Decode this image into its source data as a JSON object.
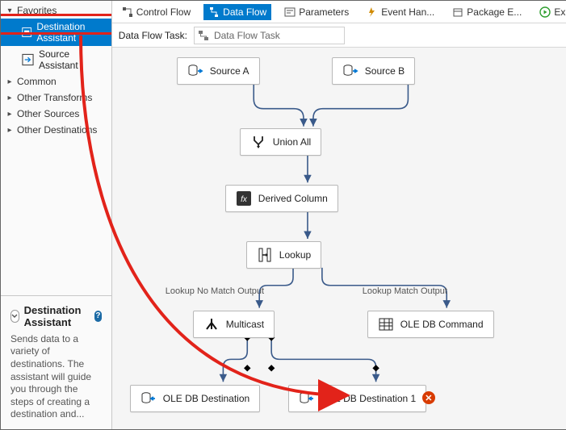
{
  "sidebar": {
    "categories": [
      {
        "label": "Favorites",
        "expanded": true,
        "items": [
          {
            "label": "Destination Assistant",
            "selected": true,
            "highlight": true
          },
          {
            "label": "Source Assistant"
          }
        ]
      },
      {
        "label": "Common",
        "expanded": false
      },
      {
        "label": "Other Transforms",
        "expanded": false
      },
      {
        "label": "Other Sources",
        "expanded": false
      },
      {
        "label": "Other Destinations",
        "expanded": false
      }
    ]
  },
  "info": {
    "title": "Destination Assistant",
    "description": "Sends data to a variety of destinations. The assistant will guide you through the steps of creating a destination and..."
  },
  "tabs": [
    {
      "label": "Control Flow",
      "active": false
    },
    {
      "label": "Data Flow",
      "active": true
    },
    {
      "label": "Parameters",
      "active": false
    },
    {
      "label": "Event Han...",
      "active": false
    },
    {
      "label": "Package E...",
      "active": false
    },
    {
      "label": "Ex",
      "active": false,
      "run": true
    }
  ],
  "task": {
    "label": "Data Flow Task:",
    "value": "Data Flow Task"
  },
  "nodes": {
    "sourceA": "Source A",
    "sourceB": "Source B",
    "union": "Union All",
    "derived": "Derived Column",
    "lookup": "Lookup",
    "multicast": "Multicast",
    "olecmd": "OLE DB Command",
    "dest1": "OLE DB Destination",
    "dest2": "OLE DB Destination 1"
  },
  "edgeLabels": {
    "noMatch": "Lookup No Match Output",
    "match": "Lookup Match Output"
  },
  "colors": {
    "accent": "#007acc",
    "edge": "#3a5a8a",
    "annotation": "#e2231a",
    "error": "#d83b01"
  }
}
